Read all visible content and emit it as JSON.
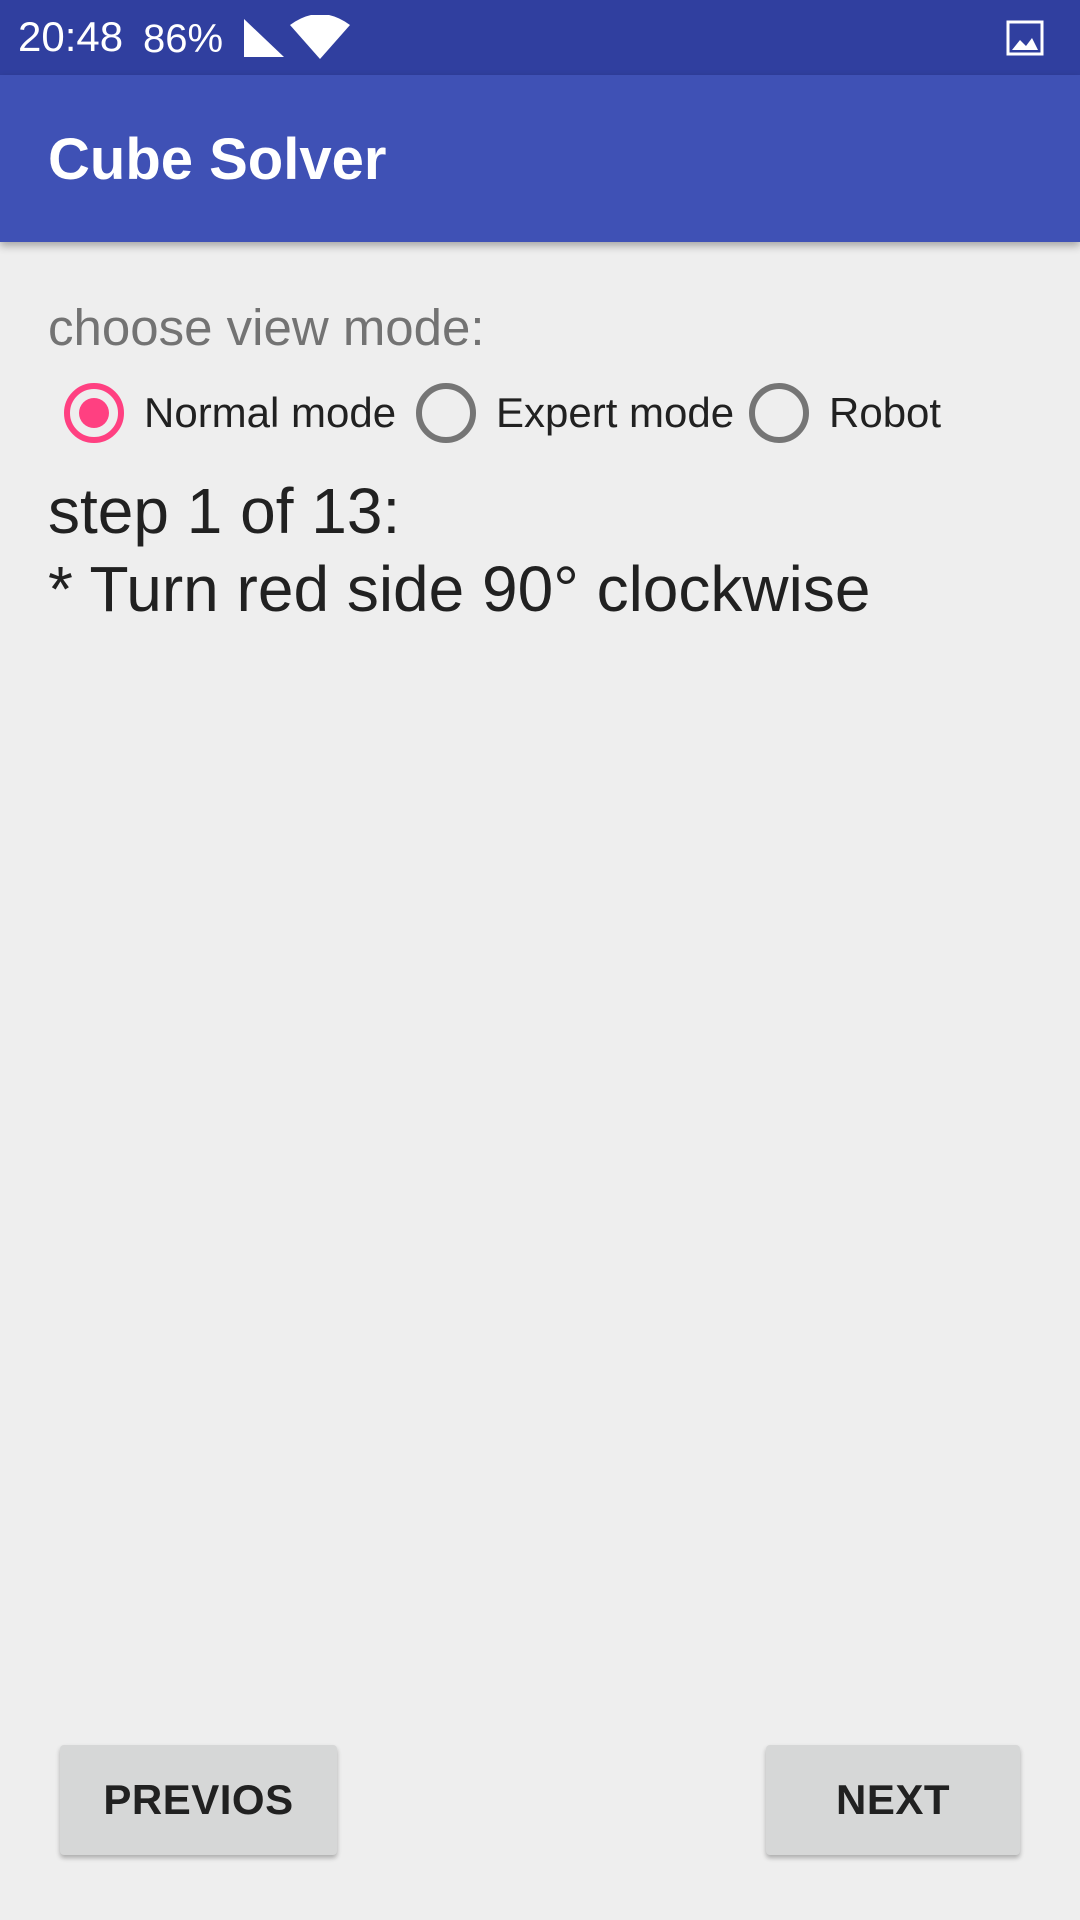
{
  "status_bar": {
    "time": "20:48",
    "battery": "86%",
    "icons": [
      "signal-icon",
      "wifi-icon",
      "image-icon"
    ]
  },
  "app_bar": {
    "title": "Cube Solver"
  },
  "view_mode": {
    "label": "choose view mode:",
    "options": [
      {
        "label": "Normal mode",
        "selected": true
      },
      {
        "label": "Expert mode",
        "selected": false
      },
      {
        "label": "Robot",
        "selected": false
      }
    ]
  },
  "step": {
    "header": "step 1 of 13:",
    "instruction": "* Turn red side 90° clockwise"
  },
  "buttons": {
    "previous_label": "PREVIOS",
    "next_label": "NEXT"
  },
  "colors": {
    "status_bar": "#303f9f",
    "app_bar": "#3f51b5",
    "accent": "#ff4081",
    "background": "#eeeeee",
    "button": "#d6d7d7"
  }
}
